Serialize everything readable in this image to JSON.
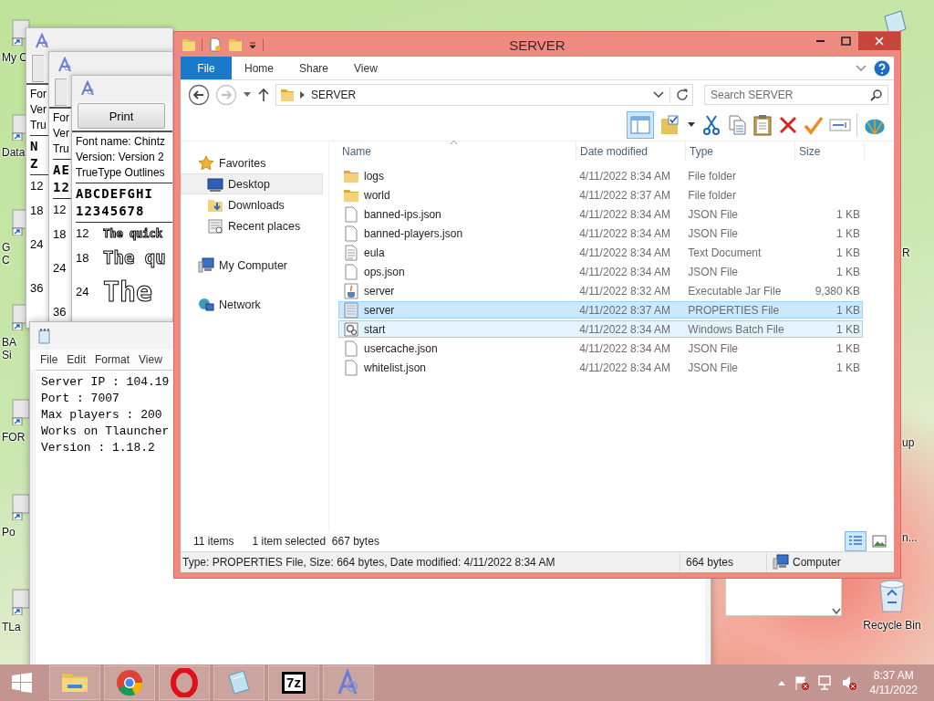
{
  "desktop": {
    "left_icons": [
      {
        "lines": [
          "My C"
        ]
      },
      {
        "lines": [
          "Data"
        ]
      },
      {
        "lines": [
          "G",
          "C"
        ]
      },
      {
        "lines": [
          "BA",
          "Si"
        ]
      },
      {
        "lines": [
          "FOR"
        ]
      },
      {
        "lines": [
          "Po"
        ]
      },
      {
        "lines": [
          "TLa"
        ]
      }
    ],
    "right_icons": [
      {
        "lines": [
          "R"
        ]
      },
      {
        "lines": [
          "up"
        ]
      },
      {
        "lines": [
          "n..."
        ]
      }
    ],
    "recycle_bin": {
      "label": "Recycle Bin"
    }
  },
  "font_viewers": [
    {
      "info": [
        "For",
        "Ver",
        "Tru"
      ],
      "charset": [
        "N",
        "Z"
      ],
      "sizes": [
        "12",
        "18",
        "24",
        "36"
      ]
    },
    {
      "info": [
        "For",
        "Ver",
        "Tru"
      ],
      "charset": [
        "AE",
        "12"
      ],
      "sizes": [
        "12",
        "18",
        "24",
        "36"
      ]
    },
    {
      "button": "Print",
      "info": [
        "Font name: Chintz",
        "Version: Version 2",
        "TrueType Outlines"
      ],
      "charset": [
        "ABCDEFGHI",
        "12345678"
      ],
      "samples": [
        {
          "size": "12",
          "text": "The quick"
        },
        {
          "size": "18",
          "text": "The qu"
        },
        {
          "size": "24",
          "text": "The"
        }
      ]
    }
  ],
  "notepad": {
    "menu": [
      "File",
      "Edit",
      "Format",
      "View"
    ],
    "lines": [
      "Server IP : 104.19",
      "Port : 7007",
      "Max players : 200",
      "Works on Tlauncher",
      "Version : 1.18.2"
    ]
  },
  "explorer": {
    "title": "SERVER",
    "file_tab": "File",
    "tabs": [
      {
        "label": "Home",
        "selected": false
      },
      {
        "label": "Share",
        "selected": false
      },
      {
        "label": "View",
        "selected": false
      }
    ],
    "address": "SERVER",
    "search": {
      "placeholder": "Search SERVER"
    },
    "preview_pane": {
      "on": true
    },
    "nav": [
      {
        "label": "Favorites",
        "kind": "favorites",
        "selected": false,
        "children": [
          {
            "label": "Desktop",
            "kind": "desktop",
            "selected": true
          },
          {
            "label": "Downloads",
            "kind": "downloads",
            "selected": false
          },
          {
            "label": "Recent places",
            "kind": "recent",
            "selected": false
          }
        ]
      },
      {
        "label": "My Computer",
        "kind": "computer",
        "selected": false
      },
      {
        "label": "Network",
        "kind": "network",
        "selected": false
      }
    ],
    "columns": [
      "Name",
      "Date modified",
      "Type",
      "Size"
    ],
    "rows": [
      {
        "name": "logs",
        "kind": "folder",
        "date": "4/11/2022 8:34 AM",
        "type": "File folder",
        "size": "",
        "selected": false,
        "hovered": false
      },
      {
        "name": "world",
        "kind": "folder",
        "date": "4/11/2022 8:37 AM",
        "type": "File folder",
        "size": "",
        "selected": false,
        "hovered": false
      },
      {
        "name": "banned-ips.json",
        "kind": "file",
        "date": "4/11/2022 8:34 AM",
        "type": "JSON File",
        "size": "1 KB",
        "selected": false,
        "hovered": false
      },
      {
        "name": "banned-players.json",
        "kind": "file",
        "date": "4/11/2022 8:34 AM",
        "type": "JSON File",
        "size": "1 KB",
        "selected": false,
        "hovered": false
      },
      {
        "name": "eula",
        "kind": "text",
        "date": "4/11/2022 8:34 AM",
        "type": "Text Document",
        "size": "1 KB",
        "selected": false,
        "hovered": false
      },
      {
        "name": "ops.json",
        "kind": "file",
        "date": "4/11/2022 8:34 AM",
        "type": "JSON File",
        "size": "1 KB",
        "selected": false,
        "hovered": false
      },
      {
        "name": "server",
        "kind": "jar",
        "date": "4/11/2022 8:32 AM",
        "type": "Executable Jar File",
        "size": "9,380 KB",
        "selected": false,
        "hovered": false
      },
      {
        "name": "server",
        "kind": "properties",
        "date": "4/11/2022 8:37 AM",
        "type": "PROPERTIES File",
        "size": "1 KB",
        "selected": true,
        "hovered": false
      },
      {
        "name": "start",
        "kind": "batch",
        "date": "4/11/2022 8:34 AM",
        "type": "Windows Batch File",
        "size": "1 KB",
        "selected": false,
        "hovered": true
      },
      {
        "name": "usercache.json",
        "kind": "file",
        "date": "4/11/2022 8:34 AM",
        "type": "JSON File",
        "size": "1 KB",
        "selected": false,
        "hovered": false
      },
      {
        "name": "whitelist.json",
        "kind": "file",
        "date": "4/11/2022 8:34 AM",
        "type": "JSON File",
        "size": "1 KB",
        "selected": false,
        "hovered": false
      }
    ],
    "status": {
      "count": "11 items",
      "selection": "1 item selected  667 bytes"
    },
    "details": {
      "info": "Type: PROPERTIES File, Size: 664 bytes, Date modified: 4/11/2022 8:34 AM",
      "size": "664 bytes",
      "zone": "Computer"
    }
  },
  "taskbar": {
    "apps": [
      {
        "kind": "explorer"
      },
      {
        "kind": "chrome"
      },
      {
        "kind": "opera"
      },
      {
        "kind": "notepad"
      },
      {
        "kind": "archiver",
        "text": "7z"
      },
      {
        "kind": "fontviewer"
      }
    ],
    "time": "8:37 AM",
    "date": "4/11/2022"
  }
}
